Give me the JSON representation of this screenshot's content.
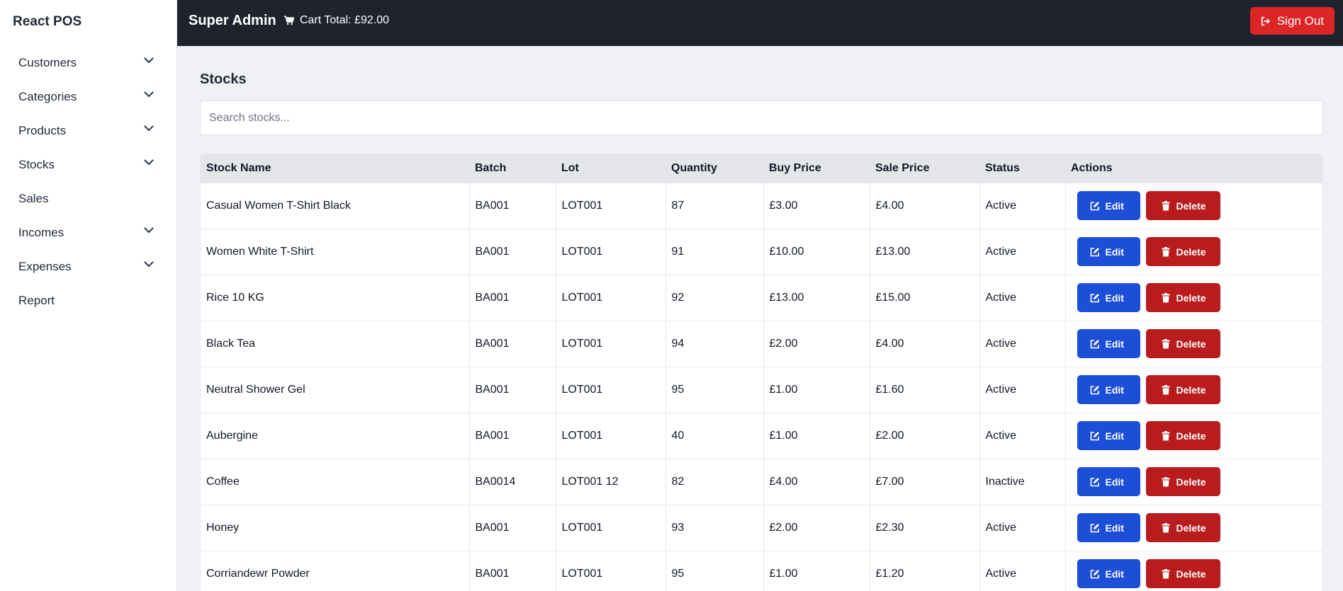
{
  "sidebar": {
    "brand": "React POS",
    "items": [
      {
        "label": "Customers",
        "expandable": true
      },
      {
        "label": "Categories",
        "expandable": true
      },
      {
        "label": "Products",
        "expandable": true
      },
      {
        "label": "Stocks",
        "expandable": true
      },
      {
        "label": "Sales",
        "expandable": false
      },
      {
        "label": "Incomes",
        "expandable": true
      },
      {
        "label": "Expenses",
        "expandable": true
      },
      {
        "label": "Report",
        "expandable": false
      }
    ]
  },
  "header": {
    "title": "Super Admin",
    "cart_total": "Cart Total: £92.00",
    "signout_label": "Sign Out"
  },
  "main": {
    "title": "Stocks",
    "search_placeholder": "Search stocks...",
    "search_value": ""
  },
  "table": {
    "columns": [
      "Stock Name",
      "Batch",
      "Lot",
      "Quantity",
      "Buy Price",
      "Sale Price",
      "Status",
      "Actions"
    ],
    "edit_label": "Edit",
    "delete_label": "Delete",
    "rows": [
      [
        "Casual Women T-Shirt Black",
        "BA001",
        "LOT001",
        "87",
        "£3.00",
        "£4.00",
        "Active"
      ],
      [
        "Women White T-Shirt",
        "BA001",
        "LOT001",
        "91",
        "£10.00",
        "£13.00",
        "Active"
      ],
      [
        "Rice 10 KG",
        "BA001",
        "LOT001",
        "92",
        "£13.00",
        "£15.00",
        "Active"
      ],
      [
        "Black Tea",
        "BA001",
        "LOT001",
        "94",
        "£2.00",
        "£4.00",
        "Active"
      ],
      [
        "Neutral Shower Gel",
        "BA001",
        "LOT001",
        "95",
        "£1.00",
        "£1.60",
        "Active"
      ],
      [
        "Aubergine",
        "BA001",
        "LOT001",
        "40",
        "£1.00",
        "£2.00",
        "Active"
      ],
      [
        "Coffee",
        "BA0014",
        "LOT001 12",
        "82",
        "£4.00",
        "£7.00",
        "Inactive"
      ],
      [
        "Honey",
        "BA001",
        "LOT001",
        "93",
        "£2.00",
        "£2.30",
        "Active"
      ],
      [
        "Corriandewr Powder",
        "BA001",
        "LOT001",
        "95",
        "£1.00",
        "£1.20",
        "Active"
      ]
    ]
  },
  "colors": {
    "topbar": "#1e232e",
    "edit": "#1d4ed8",
    "delete": "#b91c1c",
    "signout": "#dc2626"
  }
}
